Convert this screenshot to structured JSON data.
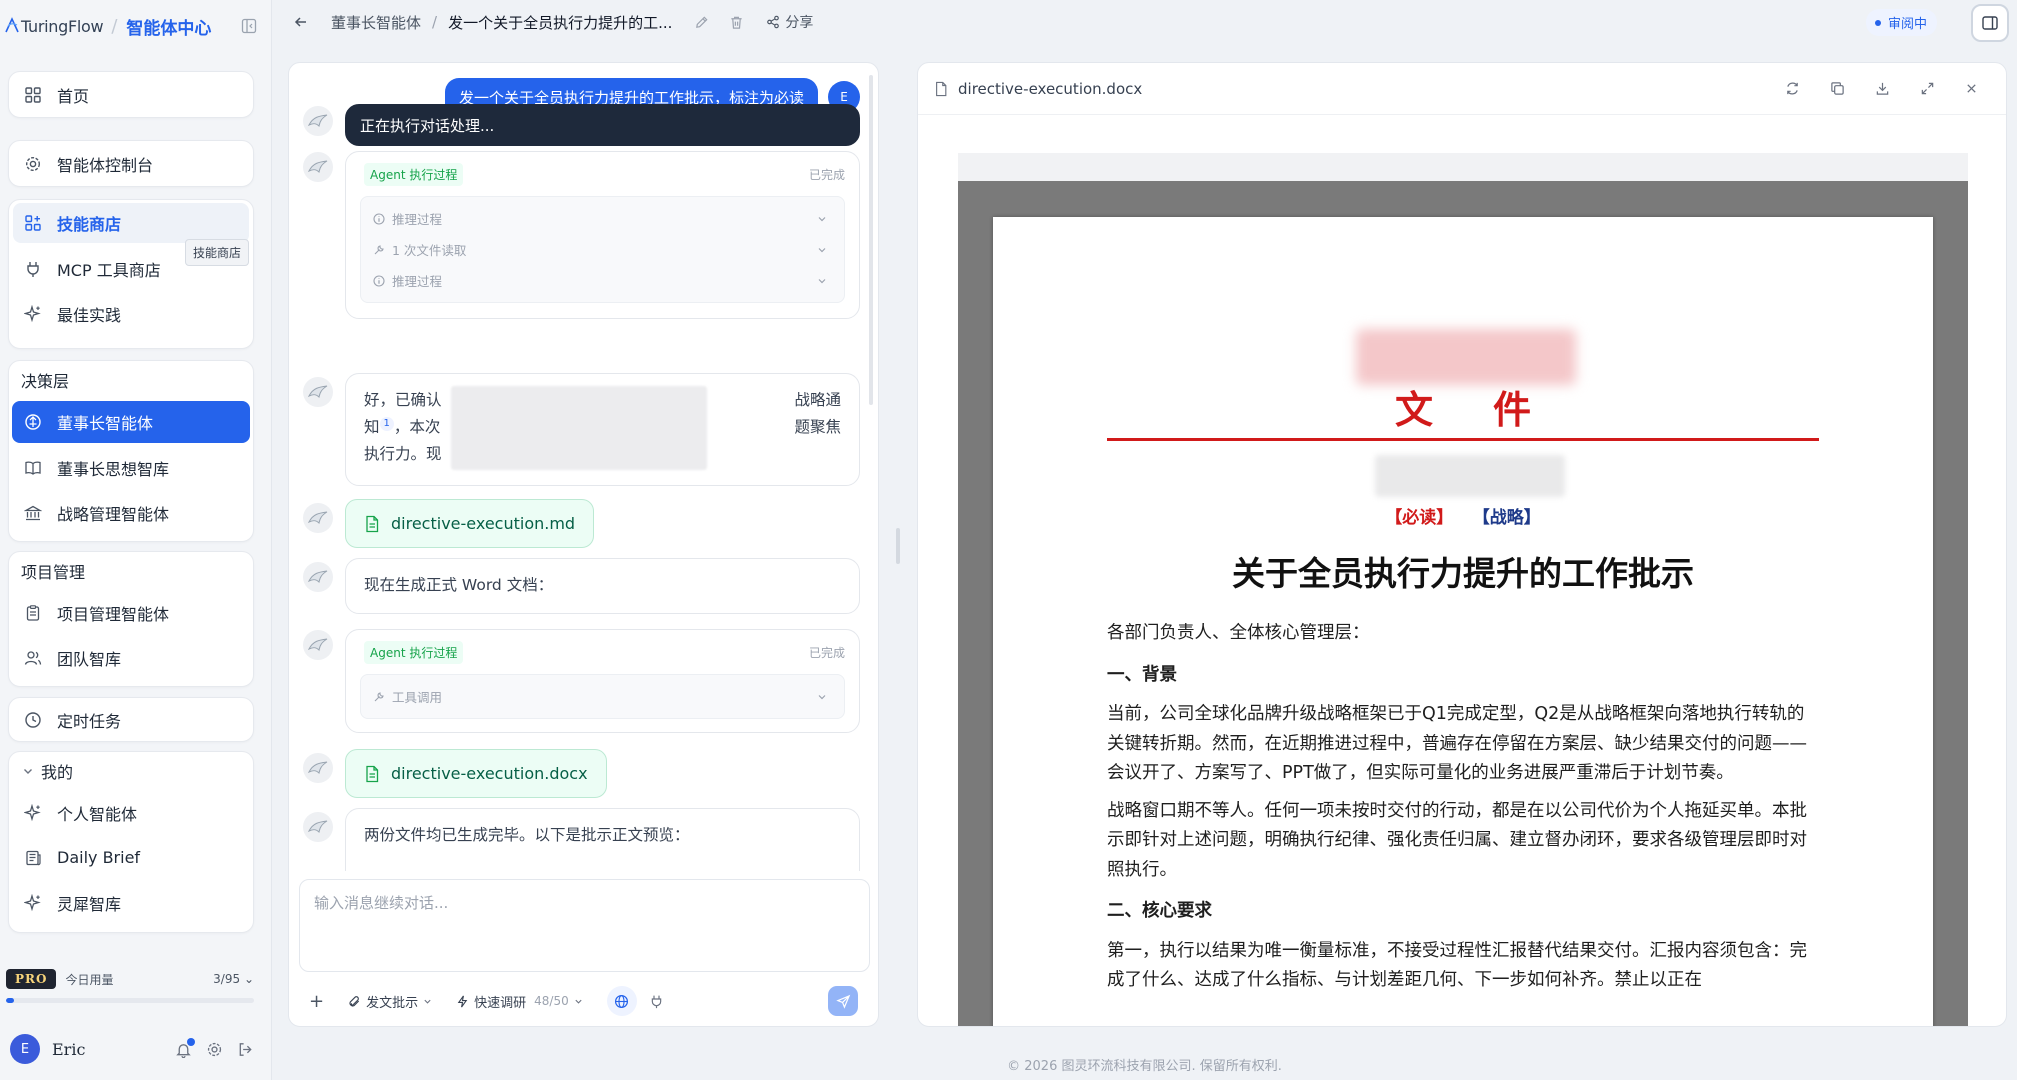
{
  "app": {
    "logo_text": "TuringFlow",
    "title": "智能体中心"
  },
  "sidebar": {
    "home": "首页",
    "console": "智能体控制台",
    "market": {
      "items": [
        {
          "label": "技能商店"
        },
        {
          "label": "MCP 工具商店"
        },
        {
          "label": "最佳实践"
        }
      ],
      "tooltip": "技能商店"
    },
    "decision": {
      "title": "决策层",
      "items": [
        {
          "label": "董事长智能体"
        },
        {
          "label": "董事长思想智库"
        },
        {
          "label": "战略管理智能体"
        }
      ]
    },
    "project": {
      "title": "项目管理",
      "items": [
        {
          "label": "项目管理智能体"
        },
        {
          "label": "团队智库"
        }
      ]
    },
    "scheduled": "定时任务",
    "mine": {
      "title": "我的",
      "items": [
        {
          "label": "个人智能体"
        },
        {
          "label": "Daily Brief"
        },
        {
          "label": "灵犀智库"
        }
      ]
    },
    "usage": {
      "badge": "PRO",
      "label": "今日用量",
      "count": "3/95",
      "fraction": 0.032
    },
    "user": {
      "initial": "E",
      "name": "Eric"
    }
  },
  "topbar": {
    "crumb": "董事长智能体",
    "current": "发一个关于全员执行力提升的工...",
    "share": "分享",
    "status": "审阅中"
  },
  "chat": {
    "user_message": "发一个关于全员执行力提升的工作批示，标注为必读",
    "user_initial": "E",
    "running": "正在执行对话处理...",
    "agent1": {
      "tag": "Agent 执行过程",
      "status": "已完成",
      "steps": [
        "推理过程",
        "1 次文件读取",
        "推理过程"
      ]
    },
    "reply": {
      "line1_a": "好，已确认",
      "line1_b": "战略通",
      "line2_a": "知",
      "cite": "1",
      "line2_b": "，本次",
      "line2_c": "题聚焦",
      "line3_a": "执行力。现"
    },
    "file1": "directive-execution.md",
    "gen_text": "现在生成正式 Word 文档：",
    "agent2": {
      "tag": "Agent 执行过程",
      "status": "已完成",
      "steps": [
        "工具调用"
      ]
    },
    "file2": "directive-execution.docx",
    "final_text": "两份文件均已生成完毕。以下是批示正文预览：",
    "composer_placeholder": "输入消息继续对话...",
    "tools": {
      "t1": "发文批示",
      "t2": "快速调研",
      "t2_count": "48/50"
    }
  },
  "preview": {
    "filename": "directive-execution.docx",
    "doc": {
      "header_char1": "文",
      "header_char2": "件",
      "tag1": "【必读】",
      "tag2": "【战略】",
      "title": "关于全员执行力提升的工作批示",
      "salutation": "各部门负责人、全体核心管理层：",
      "h1": "一、背景",
      "p1": "当前，公司全球化品牌升级战略框架已于Q1完成定型，Q2是从战略框架向落地执行转轨的关键转折期。然而，在近期推进过程中，普遍存在停留在方案层、缺少结果交付的问题——会议开了、方案写了、PPT做了，但实际可量化的业务进展严重滞后于计划节奏。",
      "p2": "战略窗口期不等人。任何一项未按时交付的行动，都是在以公司代价为个人拖延买单。本批示即针对上述问题，明确执行纪律、强化责任归属、建立督办闭环，要求各级管理层即时对照执行。",
      "h2": "二、核心要求",
      "p3": "第一，执行以结果为唯一衡量标准，不接受过程性汇报替代结果交付。汇报内容须包含：完成了什么、达成了什么指标、与计划差距几何、下一步如何补齐。禁止以正在"
    }
  },
  "footer": "© 2026 图灵环流科技有限公司. 保留所有权利."
}
